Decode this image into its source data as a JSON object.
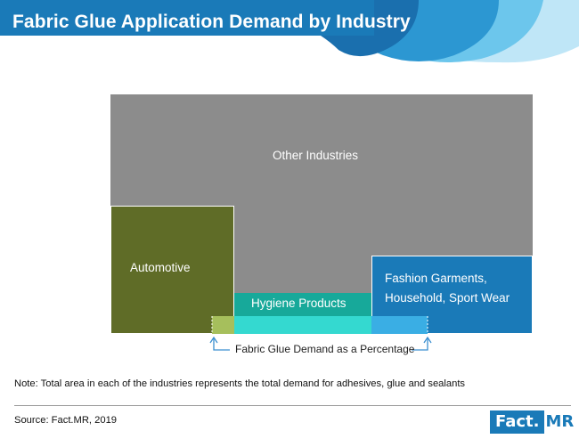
{
  "header": {
    "title": "Fabric Glue Application Demand by Industry"
  },
  "chart_data": {
    "type": "area",
    "title": "Fabric Glue Application Demand by Industry",
    "segments": [
      {
        "name": "Other Industries",
        "color": "#8c8c8c"
      },
      {
        "name": "Automotive",
        "color": "#5f6c27"
      },
      {
        "name": "Hygiene Products",
        "color": "#17a99a"
      },
      {
        "name": "Fashion Garments, Household, Sport Wear",
        "color": "#1a7ab8"
      }
    ],
    "demand_highlight_colors": {
      "automotive": "#a6bf5c",
      "hygiene": "#34d9d0",
      "fashion": "#3aaee4"
    },
    "annotation": "Fabric Glue Demand as a Percentage"
  },
  "labels": {
    "other": "Other Industries",
    "automotive": "Automotive",
    "hygiene": "Hygiene Products",
    "fashion_line1": "Fashion Garments,",
    "fashion_line2": "Household, Sport Wear",
    "demand": "Fabric Glue Demand as a Percentage"
  },
  "footer": {
    "note": "Note: Total area in each of the industries represents the total demand for adhesives, glue and sealants",
    "source": "Source: Fact.MR, 2019",
    "logo_part1": "Fact.",
    "logo_part2": "MR"
  },
  "colors": {
    "title_bar": "#1a7ab8",
    "accent_light": "#5fc0ea"
  }
}
